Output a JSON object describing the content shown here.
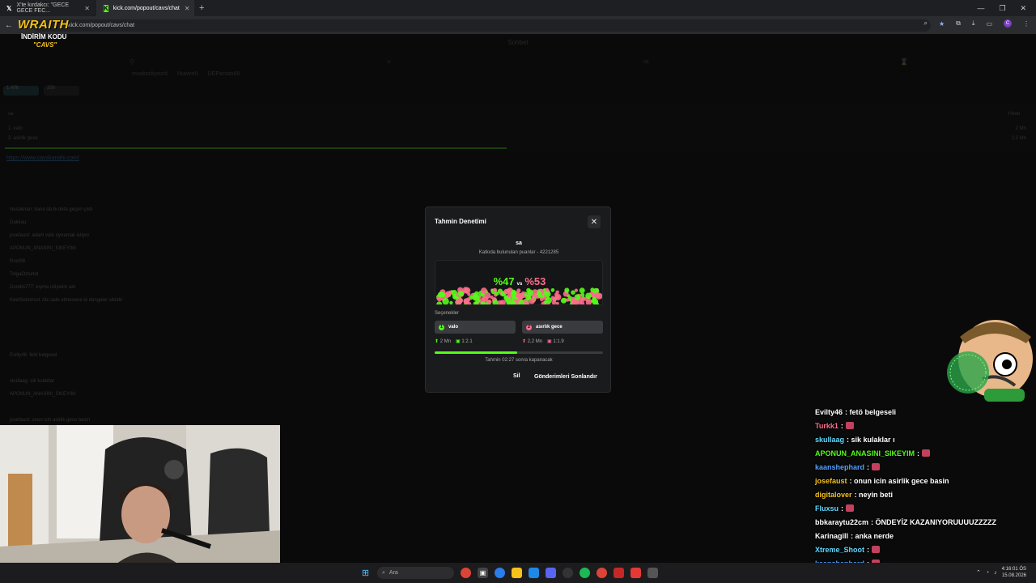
{
  "browser": {
    "tabs": [
      {
        "title": "X'te kırdakcı: \"GECE GECE FEC...",
        "icon": "x-logo-icon"
      },
      {
        "title": "kick.com/popout/cavs/chat",
        "icon": "kick-logo-icon"
      }
    ],
    "url": "kick.com/popout/cavs/chat"
  },
  "logo": {
    "brand": "WRAITH",
    "discount": "İNDİRİM KODU",
    "code": "\"CAVS\""
  },
  "page": {
    "chat_title": "Sohbet",
    "pinned_users": [
      "muskockyezid",
      "Nuwee0",
      "DEParsan68"
    ],
    "chips": [
      "1.456",
      "200"
    ],
    "prediction_bg": {
      "question": "sa",
      "manage": "Yönet",
      "options": [
        {
          "label": "1. valo",
          "value": "2 Mn"
        },
        {
          "label": "2. asirlik gece",
          "value": "2,2 Mn"
        }
      ]
    },
    "pinned_link": "https://www.cavskanahi.com/",
    "bg_chat": [
      "Nusakhan: bana da bi defa geçen çıktı",
      "Dakkau:",
      "josefaust: adam valo oynamak istiyor",
      "APONUN_ANASINI_SIKEYIM:",
      "Rost08",
      "TolgaOzturkd",
      "Dorello777: kıyma istiyelim abi",
      "KeelSebrinsol: Abi iade etmesene bi dengeler siklidir",
      "Evilty46: fetö belgesel",
      "skullaag: sik kulaklar",
      "APONUN_ANASINI_SIKEYIM:",
      "josefaust: onun icin asirlik gece basin"
    ]
  },
  "modal": {
    "title": "Tahmin Denetimi",
    "question": "sa",
    "points_text": "Katkıda bulunulan puanlar - 4221285",
    "percent_a": "%47",
    "vs": "vs",
    "percent_b": "%53",
    "percent_a_value": 47,
    "options_label": "Seçenekler",
    "option_a": {
      "label": "valo",
      "points": "2 Mn",
      "ratio": "1:2.1",
      "color": "#53fc18"
    },
    "option_b": {
      "label": "asırlık gece",
      "points": "2,2 Mn",
      "ratio": "1:1.9",
      "color": "#ff6b8b"
    },
    "timer_text": "Tahmin 02:27 sonra kapanacak",
    "delete_label": "Sil",
    "end_label": "Gönderimleri Sonlandır"
  },
  "overlay_chat": [
    {
      "user": "Evilty46",
      "color": "#ffffff",
      "text": ": fetö belgeseli"
    },
    {
      "user": "Turkk1",
      "color": "#ff6b8b",
      "text": ":"
    },
    {
      "user": "skullaag",
      "color": "#5fd9ff",
      "text": ": sik kulaklar ı"
    },
    {
      "user": "APONUN_ANASINI_SIKEYIM",
      "color": "#53fc18",
      "text": ":"
    },
    {
      "user": "kaanshephard",
      "color": "#4fa0ff",
      "text": ":"
    },
    {
      "user": "josefaust",
      "color": "#f4c21a",
      "text": ": onun icin asirlik gece basin"
    },
    {
      "user": "digitalover",
      "color": "#f4c21a",
      "text": ": neyin beti"
    },
    {
      "user": "Fluxsu",
      "color": "#5fd9ff",
      "text": ":"
    },
    {
      "user": "bbkaraytu22cm",
      "color": "#ffffff",
      "text": ": ÖNDEYİZ KAZANIYORUUUUZZZZZ"
    },
    {
      "user": "Karinagill",
      "color": "#ffffff",
      "text": ": anka nerde"
    },
    {
      "user": "Xtreme_Shoot",
      "color": "#5fd9ff",
      "text": ":"
    },
    {
      "user": "kaanshephard",
      "color": "#4fa0ff",
      "text": ":"
    }
  ],
  "taskbar": {
    "search": "Ara",
    "time": "4:16:01 ÖS",
    "date": "15.08.2026"
  }
}
